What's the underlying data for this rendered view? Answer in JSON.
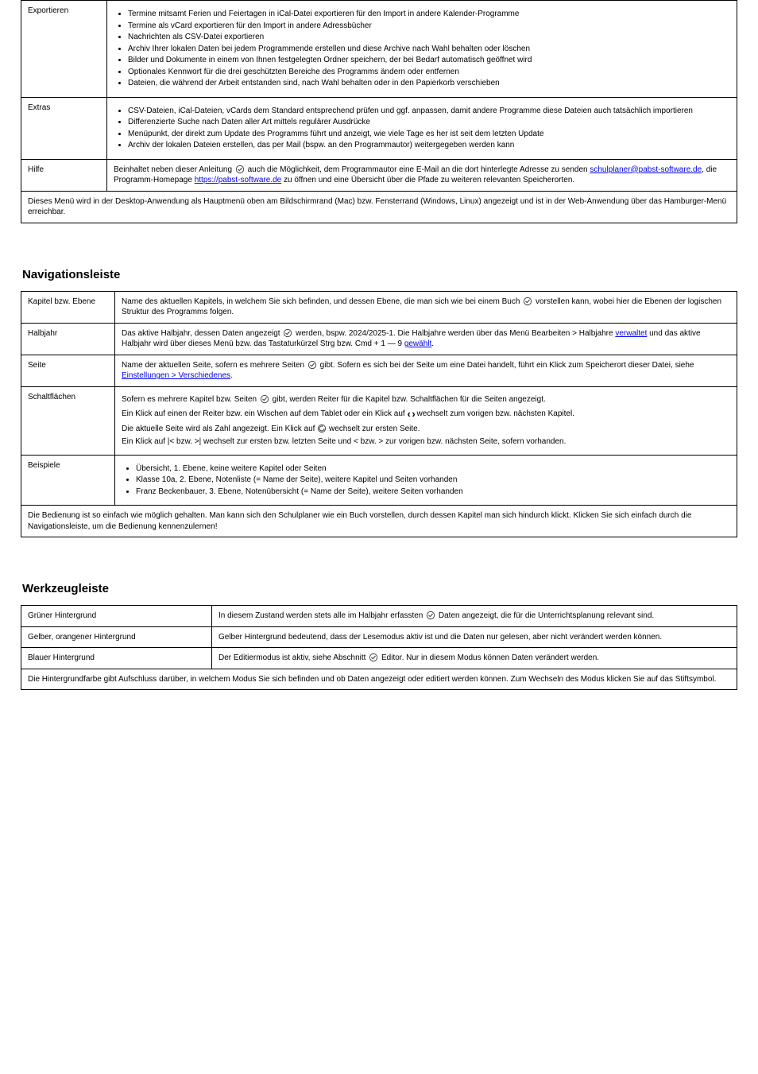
{
  "table1": {
    "rows": [
      {
        "label": "Exportieren",
        "items": [
          "Termine mitsamt Ferien und Feiertagen in iCal-Datei exportieren für den Import in andere Kalender-Programme",
          "Termine als vCard exportieren für den Import in andere Adressbücher",
          "Nachrichten als CSV-Datei exportieren",
          "Archiv Ihrer lokalen Daten bei jedem Programmende erstellen und diese Archive nach Wahl behalten oder löschen",
          "Bilder und Dokumente in einem von Ihnen festgelegten Ordner speichern, der bei Bedarf automatisch geöffnet wird",
          "Optionales Kennwort für die drei geschützten Bereiche des Programms ändern oder entfernen",
          "Dateien, die während der Arbeit entstanden sind, nach Wahl behalten oder in den Papierkorb verschieben"
        ]
      },
      {
        "label": "Extras",
        "items": [
          "CSV-Dateien, iCal-Dateien, vCards dem Standard entsprechend prüfen und ggf. anpassen, damit andere Programme diese Dateien auch tatsächlich importieren",
          "Differenzierte Suche nach Daten aller Art mittels regulärer Ausdrücke",
          "Menüpunkt, der direkt zum Update des Programms führt und anzeigt, wie viele Tage es her ist seit dem letzten Update",
          "Archiv der lokalen Dateien erstellen, das per Mail (bspw. an den Programmautor) weitergegeben werden kann"
        ]
      },
      {
        "label": "Hilfe",
        "content_parts": [
          {
            "t": "text",
            "v": "Beinhaltet neben dieser Anleitung "
          },
          {
            "t": "check"
          },
          {
            "t": "text",
            "v": " auch die Möglichkeit, dem Programmautor eine E-Mail an die dort hinterlegte Adresse zu senden "
          },
          {
            "t": "link",
            "v": "schulplaner@pabst-software.de"
          },
          {
            "t": "text",
            "v": ", die Programm-Homepage "
          },
          {
            "t": "link",
            "v": "https://pabst-software.de"
          },
          {
            "t": "text",
            "v": " zu öffnen und eine Übersicht über die Pfade zu weiteren relevanten Speicherorten."
          }
        ]
      }
    ],
    "footer": "Dieses Menü wird in der Desktop-Anwendung als Hauptmenü oben am Bildschirmrand (Mac) bzw. Fensterrand (Windows, Linux) angezeigt und ist in der Web-Anwendung über das Hamburger-Menü erreichbar."
  },
  "section2": {
    "title": "Navigationsleiste",
    "rows": [
      {
        "label": "Kapitel bzw. Ebene",
        "content_parts": [
          {
            "t": "text",
            "v": "Name des aktuellen Kapitels, in welchem Sie sich befinden, und dessen Ebene, die man sich wie bei einem Buch "
          },
          {
            "t": "check"
          },
          {
            "t": "text",
            "v": " vorstellen kann, wobei hier die Ebenen der logischen Struktur des Programms folgen."
          }
        ]
      },
      {
        "label": "Halbjahr",
        "content_parts": [
          {
            "t": "text",
            "v": "Das aktive Halbjahr, dessen Daten angezeigt "
          },
          {
            "t": "check"
          },
          {
            "t": "text",
            "v": " werden, bspw. 2024/2025-1. Die Halbjahre werden über das Menü Bearbeiten > Halbjahre "
          },
          {
            "t": "link",
            "v": "verwaltet"
          },
          {
            "t": "text",
            "v": " und das aktive Halbjahr wird über dieses Menü bzw. das Tastaturkürzel Strg bzw. Cmd + 1 — 9 "
          },
          {
            "t": "link",
            "v": "gewählt"
          },
          {
            "t": "text",
            "v": "."
          }
        ]
      },
      {
        "label": "Seite",
        "content_parts": [
          {
            "t": "text",
            "v": "Name der aktuellen Seite, sofern es mehrere Seiten "
          },
          {
            "t": "check"
          },
          {
            "t": "text",
            "v": " gibt. Sofern es sich bei der Seite um eine Datei handelt, führt ein Klick zum Speicherort dieser Datei, siehe "
          },
          {
            "t": "link",
            "v": "Einstellungen > Verschiedenes"
          },
          {
            "t": "text",
            "v": "."
          }
        ]
      },
      {
        "label": "Schaltflächen",
        "mixed": [
          {
            "type": "para",
            "parts": [
              {
                "t": "text",
                "v": "Sofern es mehrere Kapitel bzw. Seiten "
              },
              {
                "t": "check"
              },
              {
                "t": "text",
                "v": " gibt, werden Reiter für die Kapitel bzw. Schaltflächen für die Seiten angezeigt."
              }
            ]
          },
          {
            "type": "para",
            "parts": [
              {
                "t": "text",
                "v": "Ein Klick auf einen der Reiter bzw. ein Wischen auf dem Tablet oder ein Klick auf "
              },
              {
                "t": "arrows"
              },
              {
                "t": "text",
                "v": " wechselt zum vorigen bzw. nächsten Kapitel."
              }
            ]
          },
          {
            "type": "para",
            "parts": [
              {
                "t": "text",
                "v": "Die aktuelle Seite wird als Zahl angezeigt. Ein Klick auf "
              },
              {
                "t": "restore"
              },
              {
                "t": "text",
                "v": " wechselt zur ersten Seite."
              }
            ]
          },
          {
            "type": "para",
            "parts": [
              {
                "t": "text",
                "v": "Ein Klick auf |< bzw. >| wechselt zur ersten bzw. letzten Seite und < bzw. > zur vorigen bzw. nächsten Seite, sofern vorhanden."
              }
            ]
          }
        ]
      },
      {
        "label": "Beispiele",
        "items": [
          "Übersicht, 1. Ebene, keine weitere Kapitel oder Seiten",
          "Klasse 10a, 2. Ebene, Notenliste (= Name der Seite), weitere Kapitel und Seiten vorhanden",
          "Franz Beckenbauer, 3. Ebene, Notenübersicht (= Name der Seite), weitere Seiten vorhanden"
        ]
      }
    ],
    "footer": "Die Bedienung ist so einfach wie möglich gehalten. Man kann sich den Schulplaner wie ein Buch vorstellen, durch dessen Kapitel man sich hindurch klickt. Klicken Sie sich einfach durch die Navigationsleiste, um die Bedienung kennenzulernen!"
  },
  "section3": {
    "title": "Werkzeugleiste",
    "rows": [
      {
        "label": "Grüner Hintergrund",
        "content_parts": [
          {
            "t": "text",
            "v": "In diesem Zustand werden stets alle im Halbjahr erfassten "
          },
          {
            "t": "check"
          },
          {
            "t": "text",
            "v": " Daten angezeigt, die für die Unterrichtsplanung relevant sind."
          }
        ]
      },
      {
        "label": "Gelber, orangener Hintergrund",
        "content_parts": [
          {
            "t": "text",
            "v": "Gelber Hintergrund bedeutend, dass der Lesemodus aktiv ist und die Daten nur gelesen, aber nicht verändert werden können."
          }
        ]
      },
      {
        "label": "Blauer Hintergrund",
        "content_parts": [
          {
            "t": "text",
            "v": "Der Editiermodus ist aktiv, siehe Abschnitt "
          },
          {
            "t": "check"
          },
          {
            "t": "text",
            "v": " Editor. Nur in diesem Modus können Daten verändert werden."
          }
        ]
      }
    ],
    "footer": "Die Hintergrundfarbe gibt Aufschluss darüber, in welchem Modus Sie sich befinden und ob Daten angezeigt oder editiert werden können. Zum Wechseln des Modus klicken Sie auf das Stiftsymbol."
  }
}
